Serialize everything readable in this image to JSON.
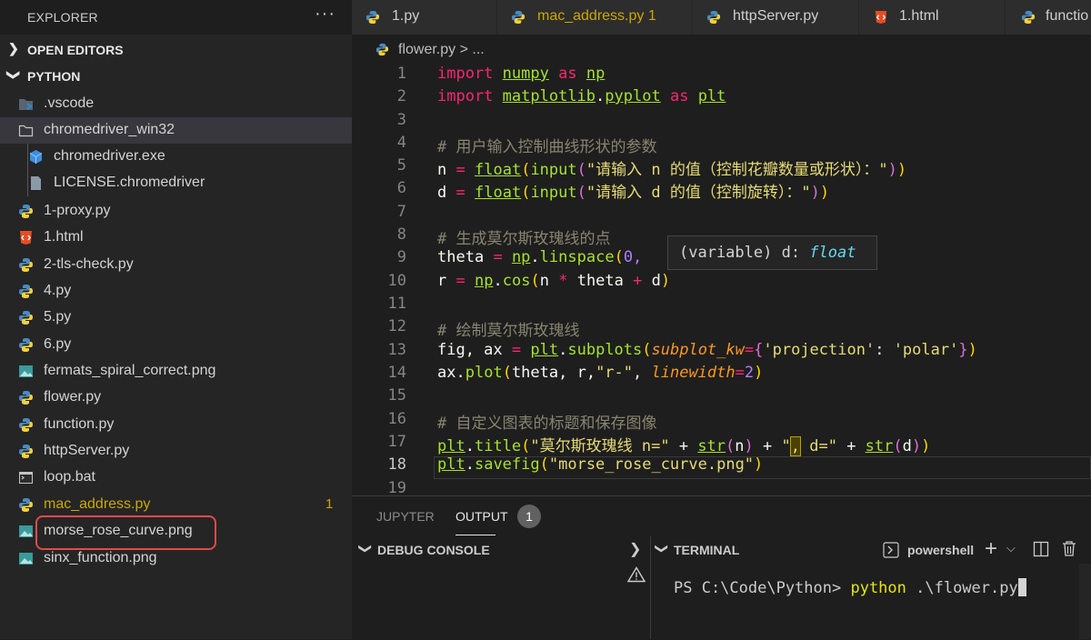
{
  "sidebar": {
    "title": "EXPLORER",
    "more": "···",
    "sections": {
      "open_editors": "OPEN EDITORS",
      "python": "PYTHON"
    },
    "items": [
      {
        "name": ".vscode",
        "icon": "vscode-folder-icon"
      },
      {
        "name": "chromedriver_win32",
        "icon": "folder-icon"
      },
      {
        "name": "chromedriver.exe",
        "icon": "exe-icon"
      },
      {
        "name": "LICENSE.chromedriver",
        "icon": "file-icon"
      },
      {
        "name": "1-proxy.py",
        "icon": "python-icon"
      },
      {
        "name": "1.html",
        "icon": "html-icon"
      },
      {
        "name": "2-tls-check.py",
        "icon": "python-icon"
      },
      {
        "name": "4.py",
        "icon": "python-icon"
      },
      {
        "name": "5.py",
        "icon": "python-icon"
      },
      {
        "name": "6.py",
        "icon": "python-icon"
      },
      {
        "name": "fermats_spiral_correct.png",
        "icon": "image-icon"
      },
      {
        "name": "flower.py",
        "icon": "python-icon"
      },
      {
        "name": "function.py",
        "icon": "python-icon"
      },
      {
        "name": "httpServer.py",
        "icon": "python-icon"
      },
      {
        "name": "loop.bat",
        "icon": "bat-icon"
      },
      {
        "name": "mac_address.py",
        "icon": "python-icon",
        "badge": "1"
      },
      {
        "name": "morse_rose_curve.png",
        "icon": "image-icon"
      },
      {
        "name": "sinx_function.png",
        "icon": "image-icon"
      }
    ]
  },
  "tabs": [
    {
      "label": "1.py",
      "icon": "python-icon"
    },
    {
      "label": "mac_address.py 1",
      "icon": "python-icon"
    },
    {
      "label": "httpServer.py",
      "icon": "python-icon"
    },
    {
      "label": "1.html",
      "icon": "html-icon"
    },
    {
      "label": "functio",
      "icon": "python-icon"
    }
  ],
  "breadcrumb": "flower.py > ...",
  "editor": {
    "active_line": 18,
    "line_numbers": [
      "1",
      "2",
      "3",
      "4",
      "5",
      "6",
      "7",
      "8",
      "9",
      "10",
      "11",
      "12",
      "13",
      "14",
      "15",
      "16",
      "17",
      "18",
      "19"
    ],
    "hover": "(variable) d: ",
    "hover_type": "float",
    "code": {
      "l1": [
        "import",
        "numpy",
        "as",
        "np"
      ],
      "l2": [
        "import",
        "matplotlib",
        ".",
        "pyplot",
        "as",
        "plt"
      ],
      "l4": "# 用户输入控制曲线形状的参数",
      "l5": [
        "n",
        "=",
        "float",
        "(",
        "input",
        "(",
        "\"请输入 n 的值（控制花瓣数量或形状）：\"",
        ")",
        ")"
      ],
      "l6": [
        "d",
        "=",
        "float",
        "(",
        "input",
        "(",
        "\"请输入 d 的值（控制旋转）：\"",
        ")",
        ")"
      ],
      "l8": "# 生成莫尔斯玫瑰线的点",
      "l9": [
        "theta",
        "=",
        "np",
        ".",
        "linspace",
        "(",
        "0,"
      ],
      "l10": [
        "r",
        "=",
        "np",
        ".",
        "cos",
        "(",
        "n",
        "*",
        "theta",
        "+",
        "d",
        ")"
      ],
      "l12": "# 绘制莫尔斯玫瑰线",
      "l13": [
        "fig, ax",
        "=",
        "plt",
        ".",
        "subplots",
        "(",
        "subplot_kw",
        "=",
        "{",
        "'projection'",
        ": ",
        "'polar'",
        "}",
        ")"
      ],
      "l14": [
        "ax",
        ".",
        "plot",
        "(",
        "theta, r,",
        "\"r-\"",
        ", ",
        "linewidth",
        "=",
        "2",
        ")"
      ],
      "l16": "# 自定义图表的标题和保存图像",
      "l17": [
        "plt",
        ".",
        "title",
        "(",
        "\"莫尔斯玫瑰线 n=\"",
        " + ",
        "str",
        "(",
        "n",
        ")",
        " + ",
        "\"",
        ",",
        " d=\"",
        " + ",
        "str",
        "(",
        "d",
        ")",
        ")"
      ],
      "l18": [
        "plt",
        ".",
        "savefig",
        "(",
        "\"morse_rose_curve.png\"",
        ")"
      ]
    }
  },
  "panel": {
    "tabs": [
      "JUPYTER",
      "OUTPUT"
    ],
    "output_badge": "1",
    "debug_console": "DEBUG CONSOLE",
    "terminal": "TERMINAL",
    "shell": "powershell",
    "prompt": "PS C:\\Code\\Python> ",
    "command": "python",
    "args": " .\\flower.py"
  },
  "colors": {
    "accent_highlight": "#e14b4b",
    "warning": "#cca700"
  }
}
